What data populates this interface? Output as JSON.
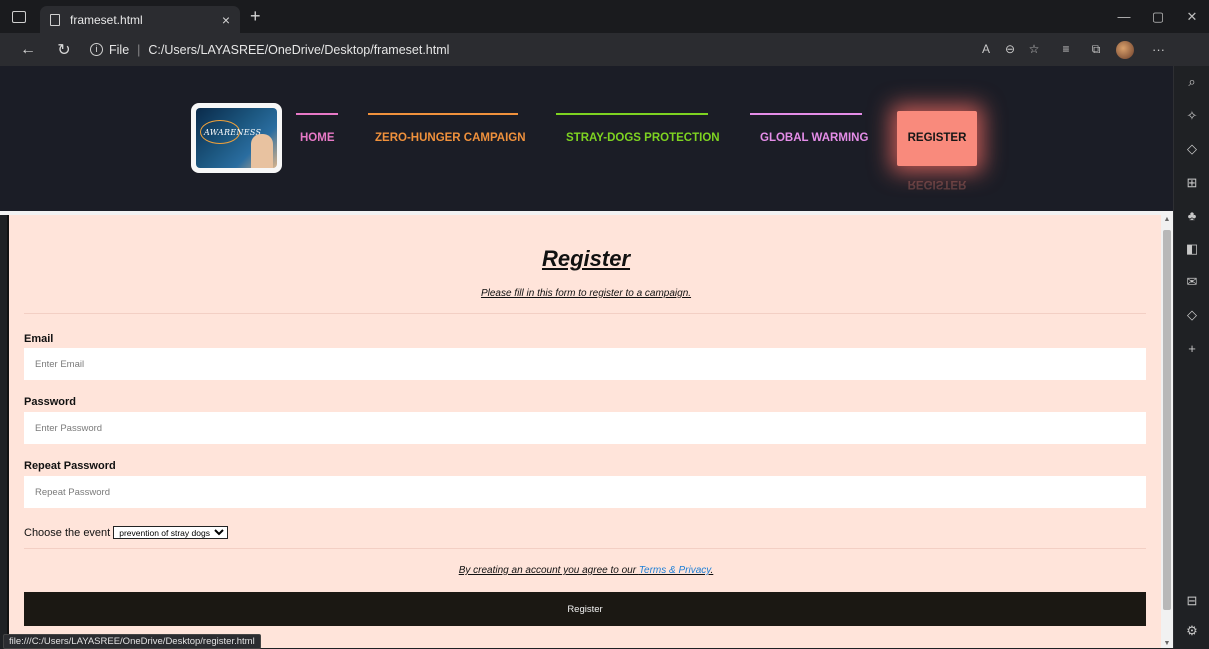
{
  "browser": {
    "tab_title": "frameset.html",
    "tab_close": "×",
    "new_tab": "+",
    "minimize": "—",
    "restore": "▢",
    "close": "✕",
    "back": "←",
    "reload": "↻",
    "url_scheme": "File",
    "url_sep": "|",
    "url": "C:/Users/LAYASREE/OneDrive/Desktop/frameset.html",
    "status_url": "file:///C:/Users/LAYASREE/OneDrive/Desktop/register.html"
  },
  "header": {
    "logo_text": "AWARENESS",
    "nav": [
      {
        "label": "HOME",
        "color": "#e879c7"
      },
      {
        "label": "ZERO-HUNGER CAMPAIGN",
        "color": "#f0913c"
      },
      {
        "label": "STRAY-DOGS PROTECTION",
        "color": "#7ed321"
      },
      {
        "label": "GLOBAL WARMING",
        "color": "#e58de8"
      }
    ],
    "register_label": "REGISTER",
    "register_color": "#f98a7c"
  },
  "form": {
    "title": "Register",
    "subtitle": "Please fill in this form to register to a campaign.",
    "email_label": "Email",
    "email_placeholder": "Enter Email",
    "password_label": "Password",
    "password_placeholder": "Enter Password",
    "repeat_label": "Repeat Password",
    "repeat_placeholder": "Repeat Password",
    "event_label": "Choose the event",
    "event_selected": "prevention of stray dogs",
    "terms_text": "By creating an account you agree to our ",
    "terms_link": "Terms & Privacy",
    "terms_end": ".",
    "submit_label": "Register"
  }
}
